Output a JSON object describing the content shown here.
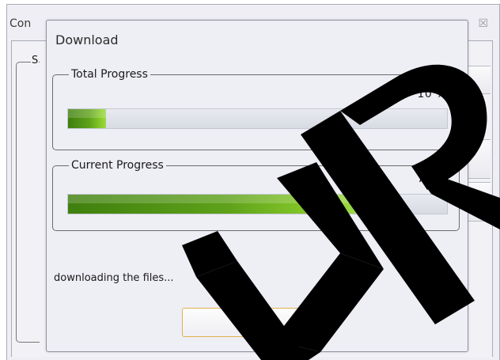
{
  "background_window": {
    "title": "Con",
    "close_glyph": "☒",
    "group_label": "S"
  },
  "dialog": {
    "title": "Download",
    "total": {
      "label": "Total Progress",
      "percent_text": "10  %",
      "value": 0.1
    },
    "current": {
      "label": "Current Progress",
      "percent_text": "76  %",
      "value": 0.76
    },
    "status_text": "downloading the files...",
    "stop_label": "Stop"
  },
  "colors": {
    "accent_green": "#5ea11a",
    "button_border": "#e0b04e",
    "watermark": "#000000"
  },
  "watermark": {
    "text": "UR",
    "icon": "watermark-letters"
  }
}
